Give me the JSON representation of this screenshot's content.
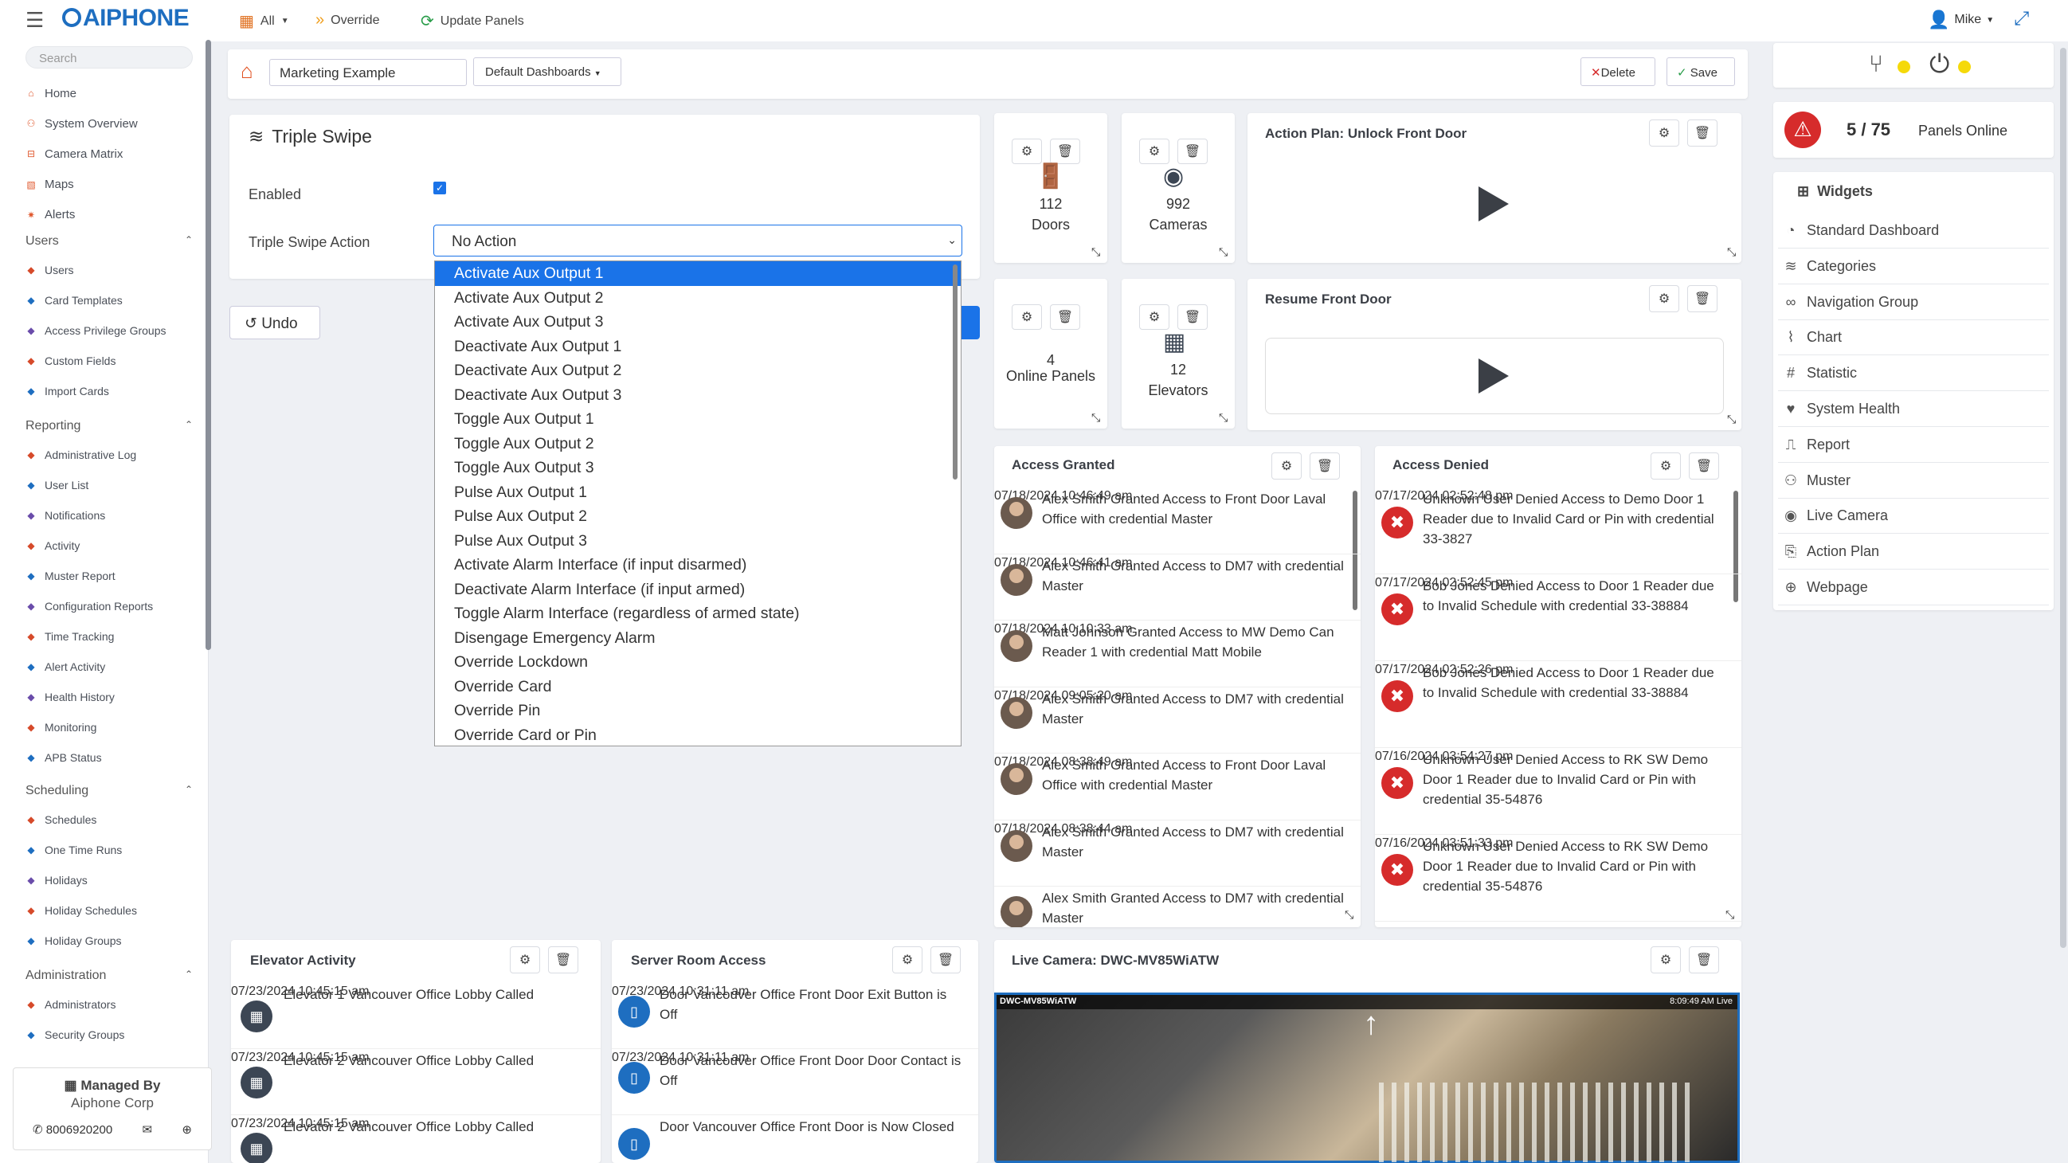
{
  "topbar": {
    "brand": "AIPHONE",
    "filter_label": "All",
    "override_label": "Override",
    "update_label": "Update Panels",
    "user_name": "Mike"
  },
  "sidebar": {
    "search_placeholder": "Search",
    "top_items": [
      "Home",
      "System Overview",
      "Camera Matrix",
      "Maps",
      "Alerts"
    ],
    "sections": [
      {
        "title": "Users",
        "items": [
          "Users",
          "Card Templates",
          "Access Privilege Groups",
          "Custom Fields",
          "Import Cards"
        ]
      },
      {
        "title": "Reporting",
        "items": [
          "Administrative Log",
          "User List",
          "Notifications",
          "Activity",
          "Muster Report",
          "Configuration Reports",
          "Time Tracking",
          "Alert Activity",
          "Health History",
          "Monitoring",
          "APB Status"
        ]
      },
      {
        "title": "Scheduling",
        "items": [
          "Schedules",
          "One Time Runs",
          "Holidays",
          "Holiday Schedules",
          "Holiday Groups"
        ]
      },
      {
        "title": "Administration",
        "items": [
          "Administrators",
          "Security Groups"
        ]
      }
    ],
    "managed_by_label": "Managed By",
    "managed_by_value": "Aiphone Corp",
    "phone": "8006920200"
  },
  "dashboard": {
    "name_value": "Marketing Example",
    "dashboards_button": "Default Dashboards",
    "delete_label": "Delete",
    "save_label": "Save"
  },
  "editor": {
    "title": "Triple Swipe",
    "enabled_label": "Enabled",
    "action_label": "Triple Swipe Action",
    "action_value": "No Action",
    "undo_label": "Undo",
    "options": [
      "Activate Aux Output 1",
      "Activate Aux Output 2",
      "Activate Aux Output 3",
      "Deactivate Aux Output 1",
      "Deactivate Aux Output 2",
      "Deactivate Aux Output 3",
      "Toggle Aux Output 1",
      "Toggle Aux Output 2",
      "Toggle Aux Output 3",
      "Pulse Aux Output 1",
      "Pulse Aux Output 2",
      "Pulse Aux Output 3",
      "Activate Alarm Interface (if input disarmed)",
      "Deactivate Alarm Interface (if input armed)",
      "Toggle Alarm Interface (regardless of armed state)",
      "Disengage Emergency Alarm",
      "Override Lockdown",
      "Override Card",
      "Override Pin",
      "Override Card or Pin"
    ]
  },
  "stats": [
    {
      "value": "112",
      "label": "Doors"
    },
    {
      "value": "992",
      "label": "Cameras"
    },
    {
      "value": "4",
      "label": "Online Panels"
    },
    {
      "value": "12",
      "label": "Elevators"
    }
  ],
  "action_plans": [
    {
      "title": "Action Plan: Unlock Front Door"
    },
    {
      "title": "Resume Front Door"
    }
  ],
  "access_granted": {
    "title": "Access Granted",
    "events": [
      {
        "text": "Alex Smith Granted Access to Front Door Laval Office with credential Master",
        "time": "07/18/2024 10:46:49 am"
      },
      {
        "text": "Alex Smith Granted Access to DM7 with credential Master",
        "time": "07/18/2024 10:46:41 am"
      },
      {
        "text": "Matt Johnson  Granted Access to MW Demo Can Reader 1 with credential Matt Mobile",
        "time": "07/18/2024 10:10:33 am"
      },
      {
        "text": "Alex Smith Granted Access to DM7 with credential Master",
        "time": "07/18/2024 09:05:20 am"
      },
      {
        "text": "Alex Smith Granted Access to Front Door Laval Office with credential Master",
        "time": "07/18/2024 08:38:49 am"
      },
      {
        "text": "Alex Smith Granted Access to DM7 with credential Master",
        "time": "07/18/2024 08:38:44 am"
      },
      {
        "text": "Alex Smith Granted Access to DM7 with credential Master",
        "time": ""
      }
    ]
  },
  "access_denied": {
    "title": "Access Denied",
    "events": [
      {
        "text": "Unknown User Denied Access to Demo Door 1 Reader due to Invalid Card or Pin with credential 33-3827",
        "time": "07/17/2024 02:52:48 pm"
      },
      {
        "text": "Bob Jones Denied Access to Door 1 Reader due to Invalid Schedule with credential 33-38884",
        "time": "07/17/2024 02:52:45 pm"
      },
      {
        "text": "Bob Jones Denied Access to Door 1 Reader due to Invalid Schedule with credential 33-38884",
        "time": "07/17/2024 02:52:26 pm"
      },
      {
        "text": "Unknown User Denied Access to RK SW Demo Door 1 Reader due to Invalid Card or Pin with credential 35-54876",
        "time": "07/16/2024 03:54:27 pm"
      },
      {
        "text": "Unknown User Denied Access to RK SW Demo Door 1 Reader due to Invalid Card or Pin with credential 35-54876",
        "time": "07/16/2024 03:51:33 pm"
      }
    ]
  },
  "elevator_activity": {
    "title": "Elevator Activity",
    "events": [
      {
        "text": "Elevator 1  Vancouver Office Lobby Called",
        "time": "07/23/2024 10:45:15 am"
      },
      {
        "text": "Elevator 2 Vancouver Office Lobby Called",
        "time": "07/23/2024 10:45:15 am"
      },
      {
        "text": "Elevator 2 Vancouver Office Lobby Called",
        "time": "07/23/2024 10:45:15 am"
      }
    ]
  },
  "server_room": {
    "title": "Server Room Access",
    "events": [
      {
        "text": "Door Vancouver Office Front Door Exit Button is Off",
        "time": "07/23/2024 10:31:11 am"
      },
      {
        "text": "Door Vancouver Office Front Door Door Contact is Off",
        "time": "07/23/2024 10:31:11 am"
      },
      {
        "text": "Door Vancouver Office Front Door is Now Closed",
        "time": ""
      }
    ]
  },
  "live_camera": {
    "title": "Live Camera: DWC-MV85WiATW",
    "overlay_name": "DWC-MV85WiATW",
    "overlay_time": "8:09:49 AM Live"
  },
  "right": {
    "panels_online_count": "5 / 75",
    "panels_online_label": "Panels Online",
    "widgets_title": "Widgets",
    "widgets": [
      {
        "label": "Standard Dashboard",
        "icon": "dashboard-icon"
      },
      {
        "label": "Categories",
        "icon": "layers-icon"
      },
      {
        "label": "Navigation Group",
        "icon": "link-icon"
      },
      {
        "label": "Chart",
        "icon": "chart-icon"
      },
      {
        "label": "Statistic",
        "icon": "hash-icon"
      },
      {
        "label": "System Health",
        "icon": "heartbeat-icon"
      },
      {
        "label": "Report",
        "icon": "report-icon"
      },
      {
        "label": "Muster",
        "icon": "group-icon"
      },
      {
        "label": "Live Camera",
        "icon": "camera-icon"
      },
      {
        "label": "Action Plan",
        "icon": "action-plan-icon"
      },
      {
        "label": "Webpage",
        "icon": "globe-icon"
      }
    ]
  },
  "colors": {
    "brand": "#1e6ec0",
    "selected": "#1a73e8",
    "danger": "#d62b2b",
    "indicator": "#f5d90a"
  }
}
